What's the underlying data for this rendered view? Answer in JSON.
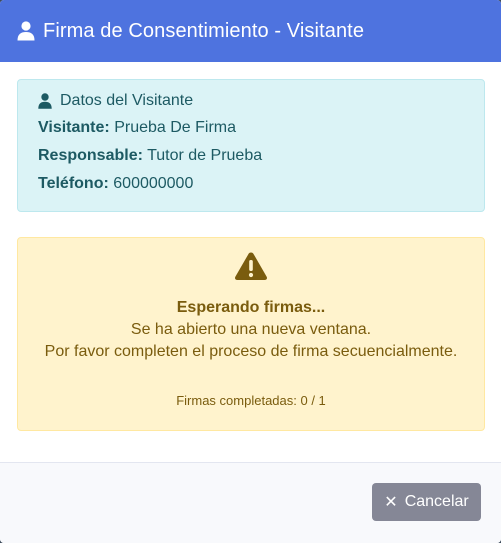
{
  "modal": {
    "title": "Firma de Consentimiento - Visitante",
    "header_icon": "user-icon"
  },
  "visitor_info": {
    "heading": "Datos del Visitante",
    "icon": "user-icon",
    "rows": [
      {
        "label": "Visitante:",
        "value": "Prueba De Firma"
      },
      {
        "label": "Responsable:",
        "value": "Tutor de Prueba"
      },
      {
        "label": "Teléfono:",
        "value": "600000000"
      }
    ]
  },
  "status": {
    "icon": "warning-triangle-icon",
    "title": "Esperando firmas...",
    "line1": "Se ha abierto una nueva ventana.",
    "line2": "Por favor completen el proceso de firma secuencialmente.",
    "progress_text": "Firmas completadas: 0 / 1"
  },
  "footer": {
    "cancel_label": "Cancelar",
    "cancel_icon": "close-icon"
  },
  "colors": {
    "header": "#4e73df",
    "info_bg": "#dbf3f6",
    "warn_bg": "#fff3cd",
    "cancel_btn": "#858796"
  }
}
